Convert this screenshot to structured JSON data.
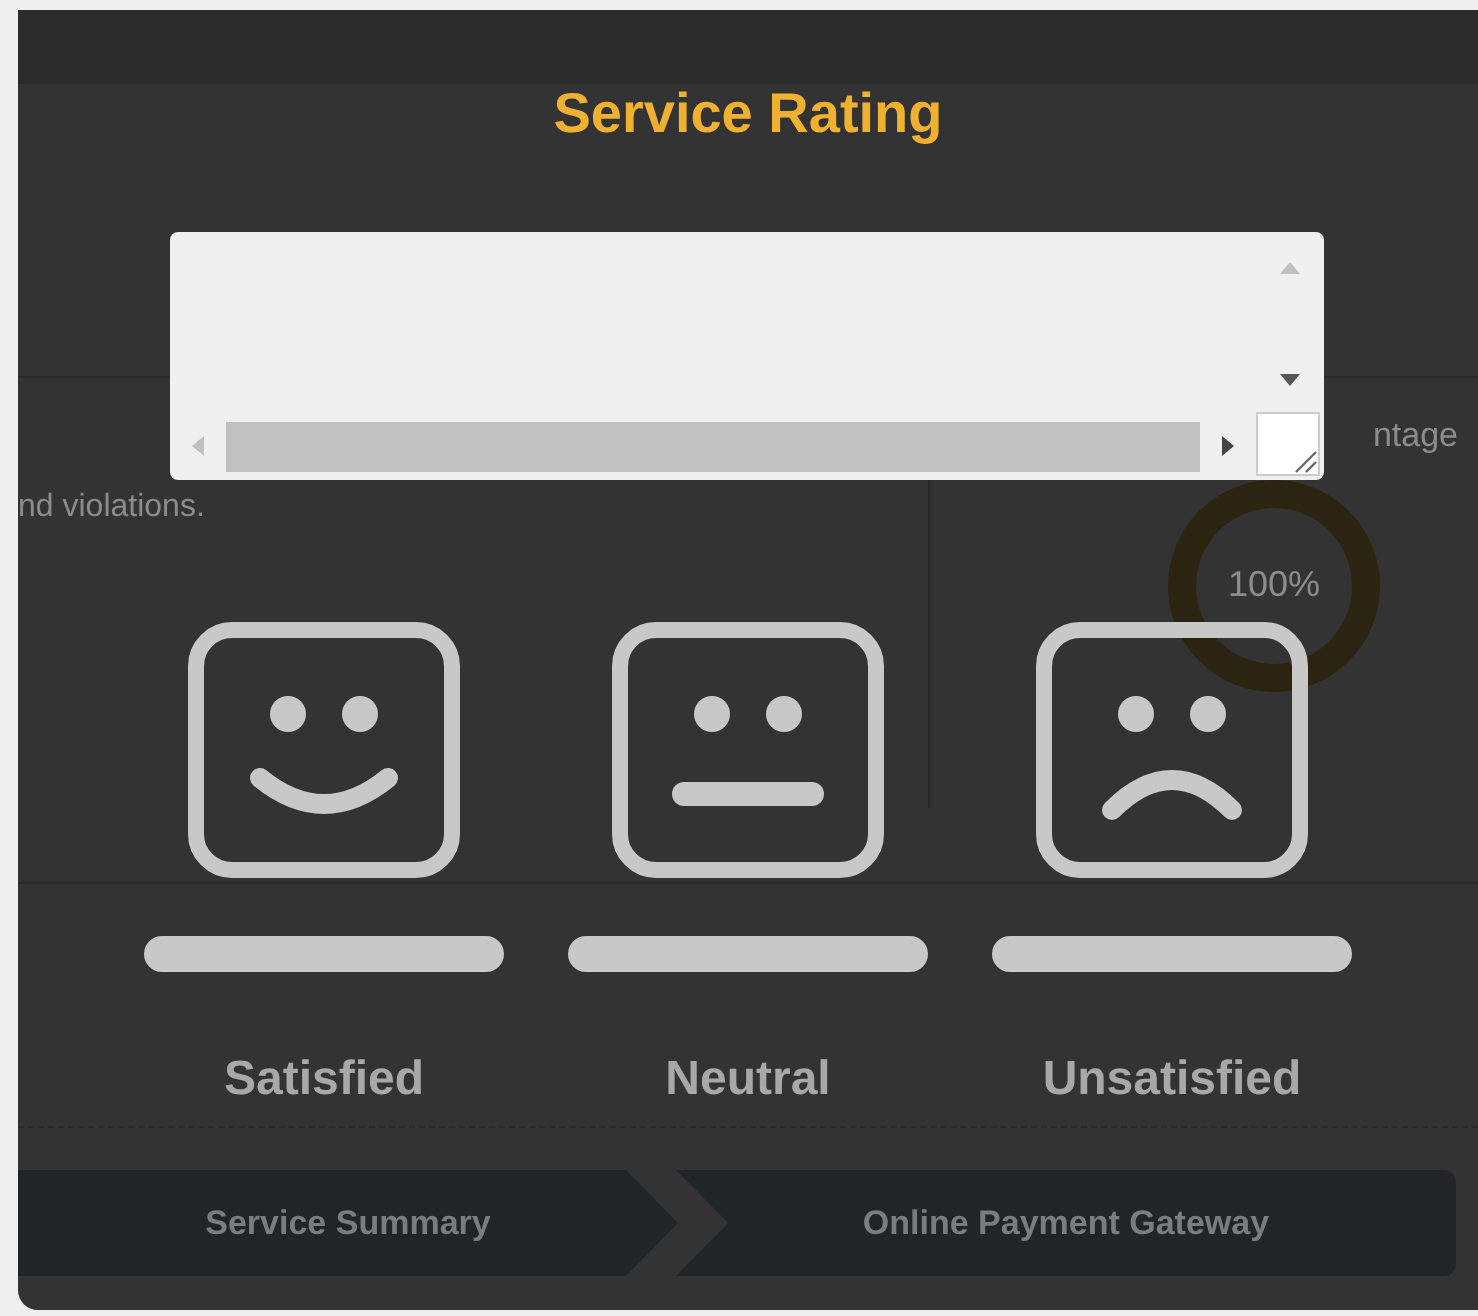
{
  "background_page": {
    "column_header_fragment": "ntage",
    "description_fragment": "nd violations.",
    "donut": {
      "label": "100%",
      "level": 1
    },
    "breadcrumbs": [
      {
        "label": "Service Summary"
      },
      {
        "label": "Online Payment Gateway"
      }
    ]
  },
  "dialog": {
    "title": "Service Rating",
    "options": [
      {
        "label": "Satisfied",
        "kind": "satisfied"
      },
      {
        "label": "Neutral",
        "kind": "neutral"
      },
      {
        "label": "Unsatisfied",
        "kind": "unsatisfied"
      }
    ]
  }
}
